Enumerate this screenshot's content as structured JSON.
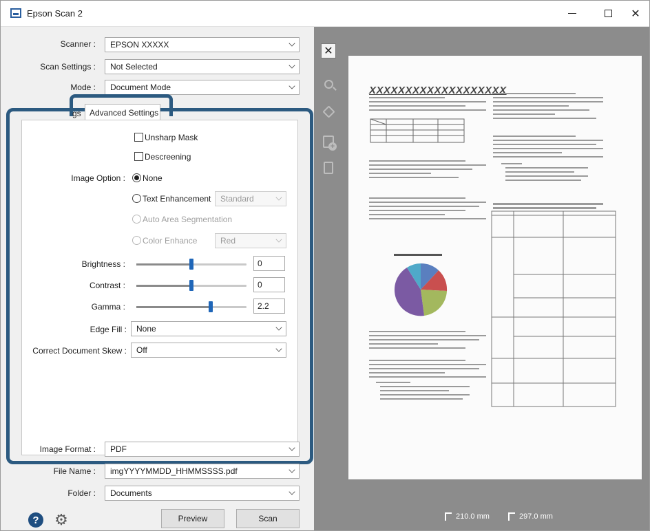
{
  "window": {
    "title": "Epson Scan 2",
    "accent_color": "#2c5a80"
  },
  "settings": {
    "scanner_label": "Scanner :",
    "scanner_value": "EPSON XXXXX",
    "scan_settings_label": "Scan Settings :",
    "scan_settings_value": "Not Selected",
    "mode_label": "Mode :",
    "mode_value": "Document Mode"
  },
  "tabs": {
    "main_partial": "gs",
    "advanced": "Advanced Settings"
  },
  "advanced": {
    "unsharp_mask": "Unsharp Mask",
    "descreening": "Descreening",
    "image_option_label": "Image Option :",
    "option_none": "None",
    "option_text_enhancement": "Text Enhancement",
    "text_enhancement_value": "Standard",
    "option_auto_area": "Auto Area Segmentation",
    "option_color_enhance": "Color Enhance",
    "color_enhance_value": "Red",
    "brightness_label": "Brightness :",
    "brightness_value": "0",
    "contrast_label": "Contrast :",
    "contrast_value": "0",
    "gamma_label": "Gamma :",
    "gamma_value": "2.2",
    "edge_fill_label": "Edge Fill :",
    "edge_fill_value": "None",
    "skew_label": "Correct Document Skew :",
    "skew_value": "Off"
  },
  "output": {
    "image_format_label": "Image Format :",
    "image_format_value": "PDF",
    "file_name_label": "File Name :",
    "file_name_value": "imgYYYYMMDD_HHMMSSSS.pdf",
    "folder_label": "Folder :",
    "folder_value": "Documents"
  },
  "buttons": {
    "preview": "Preview",
    "scan": "Scan"
  },
  "preview": {
    "doc_heading": "XXXXXXXXXXXXXXXXXXX",
    "width_readout": "210.0 mm",
    "height_readout": "297.0 mm"
  }
}
